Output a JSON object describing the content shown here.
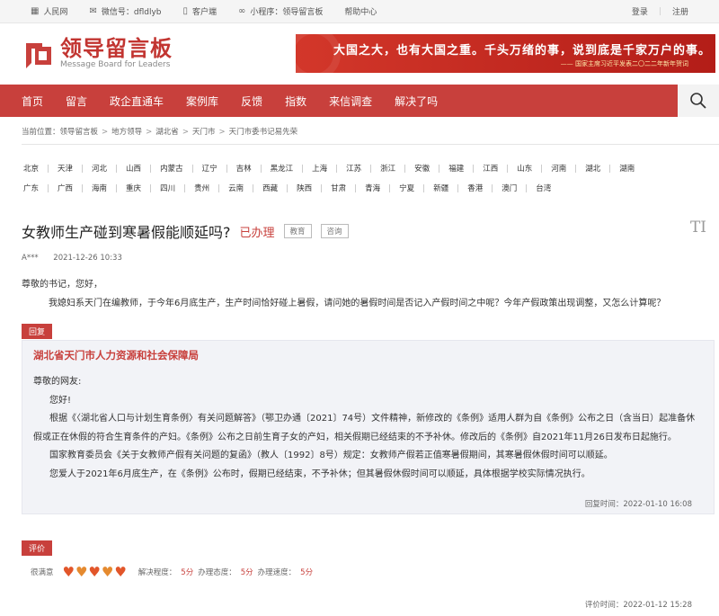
{
  "topbar": {
    "left": [
      {
        "icon": "renminwang-icon",
        "label": "人民网"
      },
      {
        "icon": "wechat-icon",
        "label": "微信号：dfldlyb"
      },
      {
        "icon": "phone-icon",
        "label": "客户端"
      },
      {
        "icon": "miniprogram-icon",
        "label": "小程序：领导留言板"
      },
      {
        "icon": "",
        "label": "帮助中心"
      }
    ],
    "login": "登录",
    "register": "注册"
  },
  "logo": {
    "cn": "领导留言板",
    "en": "Message Board for Leaders"
  },
  "banner": {
    "headline": "大国之大，也有大国之重。千头万绪的事，说到底是千家万户的事。",
    "source": "—— 国家主席习近平发表二〇二二年新年贺词"
  },
  "nav": {
    "items": [
      "首页",
      "留言",
      "政企直通车",
      "案例库",
      "反馈",
      "指数",
      "来信调查",
      "解决了吗"
    ],
    "search_icon": "search-icon"
  },
  "breadcrumb": {
    "prefix": "当前位置：",
    "items": [
      "领导留言板",
      "地方领导",
      "湖北省",
      "天门市",
      "天门市委书记易先荣"
    ]
  },
  "provinces": {
    "row1": [
      "北京",
      "天津",
      "河北",
      "山西",
      "内蒙古",
      "辽宁",
      "吉林",
      "黑龙江",
      "上海",
      "江苏",
      "浙江",
      "安徽",
      "福建",
      "江西",
      "山东",
      "河南",
      "湖北",
      "湖南"
    ],
    "row2": [
      "广东",
      "广西",
      "海南",
      "重庆",
      "四川",
      "贵州",
      "云南",
      "西藏",
      "陕西",
      "甘肃",
      "青海",
      "宁夏",
      "新疆",
      "香港",
      "澳门",
      "台湾"
    ]
  },
  "message": {
    "title": "女教师生产碰到寒暑假能顺延吗?",
    "status": "已办理",
    "tags": [
      "教育",
      "咨询"
    ],
    "font_toggle": "TI",
    "author": "A***",
    "time": "2021-12-26 10:33",
    "greeting": "尊敬的书记，您好，",
    "body": "我媳妇系天门在编教师，于今年6月底生产，生产时间恰好碰上暑假，请问她的暑假时间是否记入产假时间之中呢？今年产假政策出现调整，又怎么计算呢？"
  },
  "reply": {
    "label": "回复",
    "org": "湖北省天门市人力资源和社会保障局",
    "salutation": "尊敬的网友:",
    "hello": "您好!",
    "p1": "根据《〈湖北省人口与计划生育条例〉有关问题解答》（鄂卫办通〔2021〕74号）文件精神，新修改的《条例》适用人群为自《条例》公布之日（含当日）起准备休假或正在休假的符合生育条件的产妇。《条例》公布之日前生育子女的产妇，相关假期已经结束的不予补休。修改后的《条例》自2021年11月26日发布日起施行。",
    "p2": "国家教育委员会《关于女教师产假有关问题的复函》（教人〔1992〕8号）规定：女教师产假若正值寒暑假期间，其寒暑假休假时间可以顺延。",
    "p3": "您爱人于2021年6月底生产，在《条例》公布时，假期已经结束，不予补休；但其暑假休假时间可以顺延，具体根据学校实际情况执行。",
    "time_label": "回复时间：",
    "time": "2022-01-10 16:08"
  },
  "evaluation": {
    "label": "评价",
    "satisfaction": "很满意",
    "hearts": 5,
    "solve_label": "解决程度：",
    "solve_score": "5分",
    "attitude_label": "办理态度：",
    "attitude_score": "5分",
    "speed_label": "办理速度：",
    "speed_score": "5分",
    "time_label": "评价时间：",
    "time": "2022-01-12 15:28"
  },
  "colors": {
    "brand": "#c8403c",
    "reply_bg": "#f2f3f7",
    "heart": "#e58a2f"
  }
}
